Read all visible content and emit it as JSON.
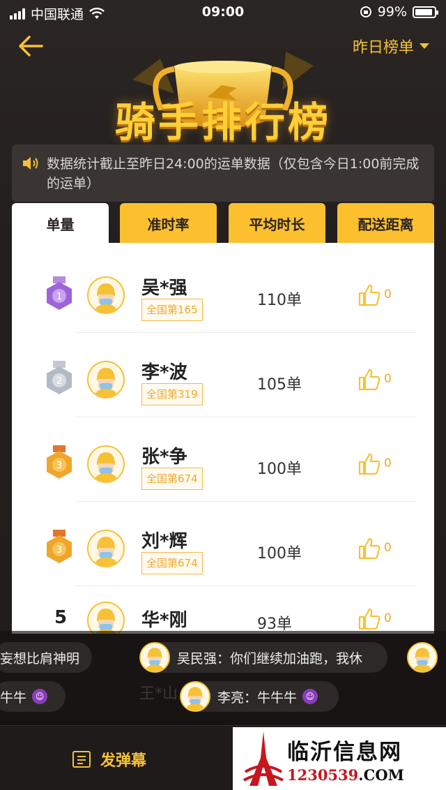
{
  "status_bar": {
    "carrier": "中国联通",
    "time": "09:00",
    "battery": "99%"
  },
  "header": {
    "title": "骑手排行榜",
    "dropdown_label": "昨日榜单"
  },
  "notice": {
    "text": "数据统计截止至昨日24:00的运单数据（仅包含今日1:00前完成的运单）"
  },
  "tabs": [
    {
      "label": "单量",
      "active": true
    },
    {
      "label": "准时率",
      "active": false
    },
    {
      "label": "平均时长",
      "active": false
    },
    {
      "label": "配送距离",
      "active": false
    }
  ],
  "riders": [
    {
      "rank": "1",
      "name": "吴*强",
      "national_rank": "全国第165",
      "orders": "110单",
      "likes": "0",
      "medal": "purple"
    },
    {
      "rank": "2",
      "name": "李*波",
      "national_rank": "全国第319",
      "orders": "105单",
      "likes": "0",
      "medal": "silver"
    },
    {
      "rank": "3",
      "name": "张*争",
      "national_rank": "全国第674",
      "orders": "100单",
      "likes": "0",
      "medal": "bronze"
    },
    {
      "rank": "3",
      "name": "刘*辉",
      "national_rank": "全国第674",
      "orders": "100单",
      "likes": "0",
      "medal": "bronze"
    },
    {
      "rank": "5",
      "name": "华*刚",
      "national_rank": "",
      "orders": "93单",
      "likes": "0",
      "medal": "none"
    }
  ],
  "danmaku": [
    {
      "text": "妄想比肩神明"
    },
    {
      "text": "吴民强：你们继续加油跑，我休"
    },
    {
      "text": "牛牛"
    },
    {
      "text": "李亮：牛牛牛"
    }
  ],
  "partial_row_name": "王*山",
  "bottom": {
    "send_label": "发弹幕"
  },
  "watermark": {
    "name": "临沂信息网",
    "domain_red": "1230539",
    "domain_black": ".COM"
  },
  "colors": {
    "accent": "#f6c136",
    "tab_inactive": "#fcc02f",
    "background": "#1f1c1b"
  }
}
